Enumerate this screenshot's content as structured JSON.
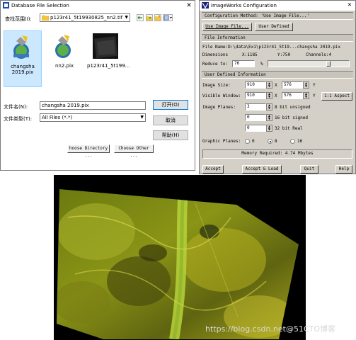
{
  "db_dialog": {
    "title": "Database File Selection",
    "look_in_label": "查找范围(I):",
    "look_in_value": "p123r41_5t19930825_nn2.tif",
    "files": [
      {
        "name": "changsha 2019.pix",
        "selected": true
      },
      {
        "name": "nn2.pix",
        "selected": false
      },
      {
        "name": "p123r41_5t199...",
        "selected": false
      }
    ],
    "filename_label": "文件名(N):",
    "filename_value": "changsha 2019.pix",
    "filetype_label": "文件类型(T):",
    "filetype_value": "All Files (*.*)",
    "open_button": "打开(O)",
    "cancel_button": "取消",
    "help_button": "帮助(H)",
    "choose_directory": "hoose Directory ...",
    "choose_other": "Choose Other ..."
  },
  "iw_dialog": {
    "title": "ImageWorks Configuration",
    "config_method": "Configuration Method: 'Use Image File...'",
    "use_image_file": "Use Image File...",
    "user_defined": "User Defined",
    "file_info_header": "File Information",
    "file_name": "File Name:D:\\data\\Ex1\\p123r41_5t19...changsha 2019.pix",
    "dimensions_label": "Dimensions",
    "dim_x": "X:1185",
    "dim_y": "Y:750",
    "channels": "Channels:4",
    "reduce_label": "Reduce to:",
    "reduce_value": "76",
    "percent": "%",
    "reduce_fraction": 0.76,
    "user_info_header": "User Defined Information",
    "image_size_label": "Image Size:",
    "image_size_x": "910",
    "image_size_y": "576",
    "visible_window_label": "Visible Window:",
    "visible_x": "910",
    "visible_y": "576",
    "x_char": "X",
    "y_char": "Y",
    "aspect_button": "1:1 Aspect",
    "image_planes_label": "Image Planes:",
    "planes": [
      {
        "value": "3",
        "label": "8 bit unsigned"
      },
      {
        "value": "0",
        "label": "16 bit signed"
      },
      {
        "value": "0",
        "label": "32 bit Real"
      }
    ],
    "graphic_planes_label": "Graphic Planes:",
    "graphic_options": [
      "0",
      "8",
      "16"
    ],
    "graphic_selected": "8",
    "memory_required": "Memory Required: 4.74 Mbytes",
    "accept": "Accept",
    "accept_load": "Accept & Load",
    "quit": "Quit",
    "help": "Help"
  },
  "watermark": "https://blog.csdn.net@51CTO博客"
}
